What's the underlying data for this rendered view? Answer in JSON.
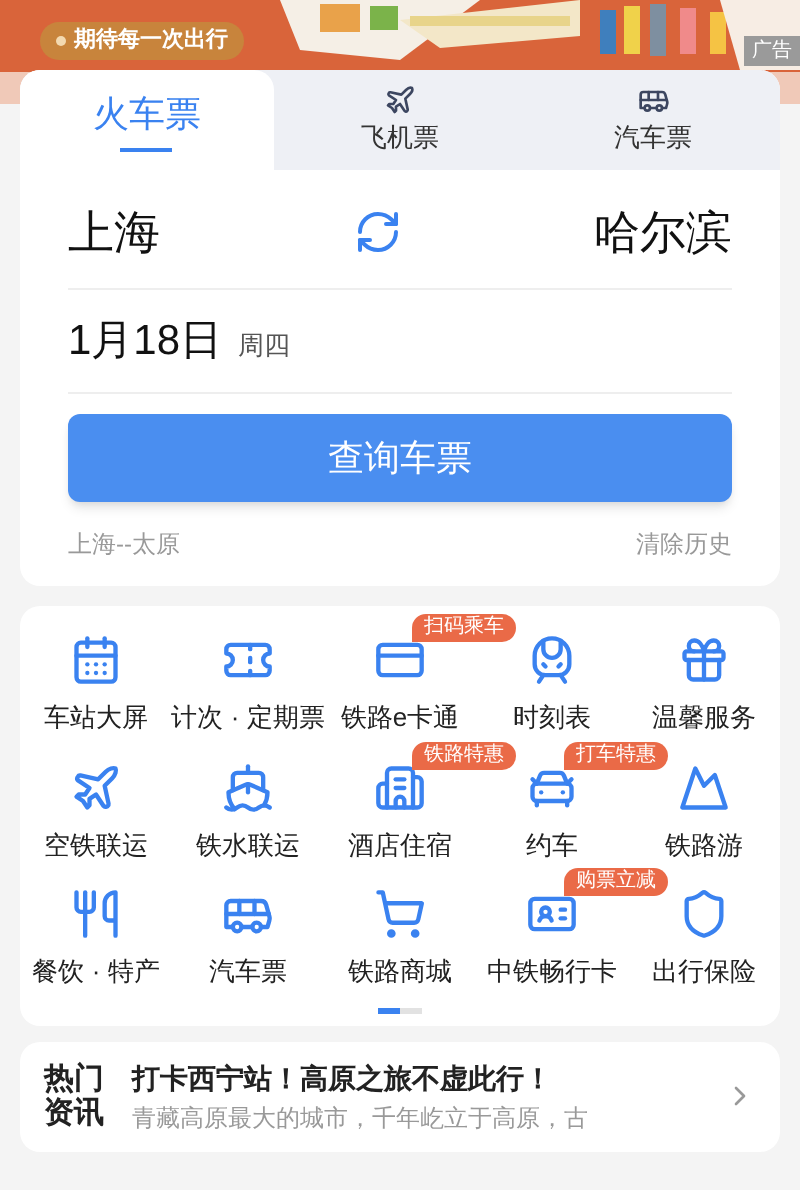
{
  "banner": {
    "kind": "picture",
    "slogan": "期待每一次出行",
    "ad_label": "广告"
  },
  "tabs": [
    {
      "label": "火车票",
      "selected": true
    },
    {
      "label": "飞机票",
      "selected": false
    },
    {
      "label": "汽车票",
      "selected": false
    }
  ],
  "search": {
    "from": "上海",
    "to": "哈尔滨",
    "date": "1月18日",
    "weekday": "周四",
    "button": "查询车票",
    "history": "上海--太原",
    "clear": "清除历史"
  },
  "services": [
    {
      "label": "车站大屏"
    },
    {
      "label": "计次 · 定期票"
    },
    {
      "label": "铁路e卡通",
      "badge": "扫码乘车"
    },
    {
      "label": "时刻表"
    },
    {
      "label": "温馨服务"
    },
    {
      "label": "空铁联运"
    },
    {
      "label": "铁水联运"
    },
    {
      "label": "酒店住宿",
      "badge": "铁路特惠"
    },
    {
      "label": "约车",
      "badge": "打车特惠"
    },
    {
      "label": "铁路游"
    },
    {
      "label": "餐饮 · 特产"
    },
    {
      "label": "汽车票"
    },
    {
      "label": "铁路商城"
    },
    {
      "label": "中铁畅行卡",
      "badge": "购票立减"
    },
    {
      "label": "出行保险"
    }
  ],
  "pager": [
    {
      "selected": true
    },
    {
      "selected": false
    }
  ],
  "news": {
    "label": "热门资讯",
    "title": "打卡西宁站！高原之旅不虚此行！",
    "summary": "青藏高原最大的城市，千年屹立于高原，古"
  }
}
